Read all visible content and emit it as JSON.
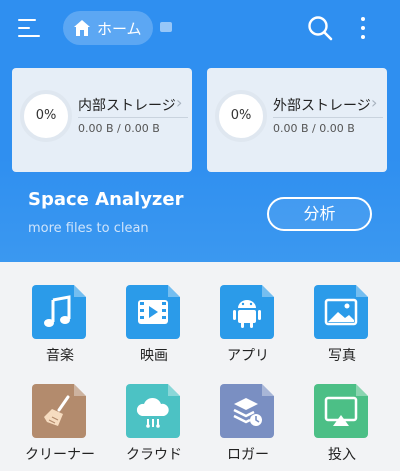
{
  "toolbar": {
    "home_label": "ホーム"
  },
  "storage": [
    {
      "name": "内部ストレージ",
      "percent": "0%",
      "size": "0.00 B / 0.00 B"
    },
    {
      "name": "外部ストレージ",
      "percent": "0%",
      "size": "0.00 B / 0.00 B"
    }
  ],
  "analyzer": {
    "title": "Space Analyzer",
    "subtitle": "more files to clean",
    "button_label": "分析"
  },
  "categories": [
    {
      "label": "音楽",
      "icon": "music-note-icon",
      "color": "#2b9be9"
    },
    {
      "label": "映画",
      "icon": "video-play-icon",
      "color": "#2b9be9"
    },
    {
      "label": "アプリ",
      "icon": "android-icon",
      "color": "#2b9be9"
    },
    {
      "label": "写真",
      "icon": "image-icon",
      "color": "#2b9be9"
    },
    {
      "label": "クリーナー",
      "icon": "broom-icon",
      "color": "#b38b6d"
    },
    {
      "label": "クラウド",
      "icon": "cloud-icon",
      "color": "#4cc2c4"
    },
    {
      "label": "ロガー",
      "icon": "layers-clock-icon",
      "color": "#7a8fc2"
    },
    {
      "label": "投入",
      "icon": "cast-icon",
      "color": "#4cbf86"
    }
  ],
  "colors": {
    "header_blue": "#2f8ff0",
    "card_bg": "#e6eef7",
    "page_bg": "#f2f3f5"
  }
}
